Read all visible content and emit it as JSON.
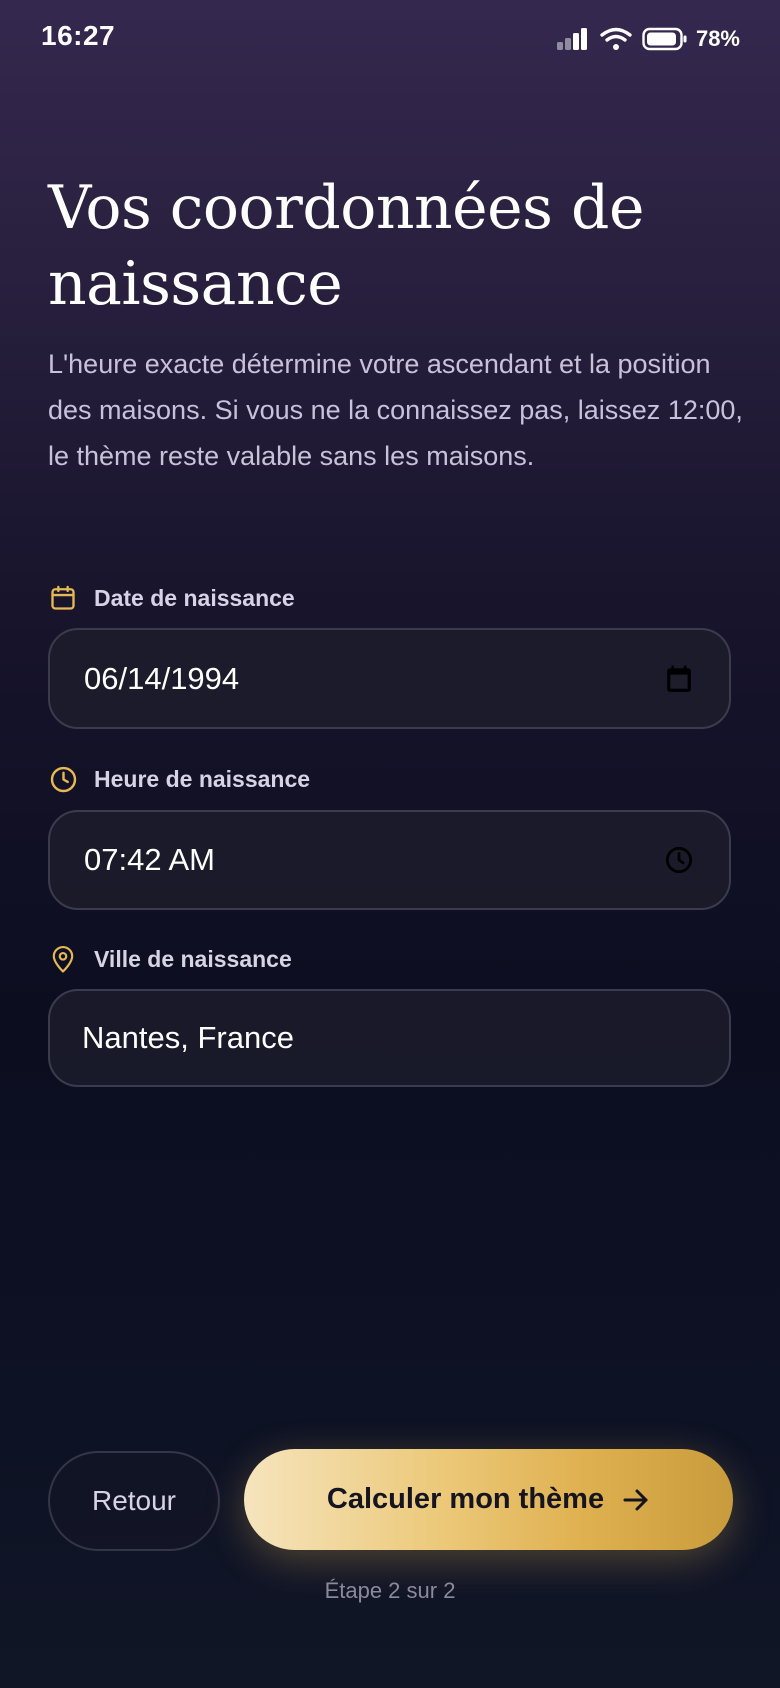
{
  "status_bar": {
    "time": "16:27",
    "battery_percent": "78%",
    "icons": [
      "signal-icon",
      "wifi-icon",
      "battery-icon"
    ]
  },
  "header": {
    "title": "Vos coordonnées de naissance",
    "subtitle": "L'heure exacte détermine votre ascendant et la position des maisons. Si vous ne la connaissez pas, laissez 12:00, le thème reste valable sans les maisons."
  },
  "form": {
    "date": {
      "label": "Date de naissance",
      "value": "06/14/1994",
      "label_icon": "calendar-icon",
      "trailing_icon": "calendar-picker-icon"
    },
    "time": {
      "label": "Heure de naissance",
      "value": "07:42 AM",
      "label_icon": "clock-icon",
      "trailing_icon": "clock-picker-icon"
    },
    "city": {
      "label": "Ville de naissance",
      "value": "Nantes, France",
      "label_icon": "location-pin-icon"
    }
  },
  "actions": {
    "back_label": "Retour",
    "primary_label": "Calculer mon thème",
    "primary_icon": "arrow-right-icon"
  },
  "footer": {
    "step_text": "Étape 2 sur 2"
  },
  "colors": {
    "accent_gold": "#e7b954",
    "background_top": "#35284f",
    "background_bottom": "#0d1224",
    "text_muted": "#c9c1d9"
  }
}
